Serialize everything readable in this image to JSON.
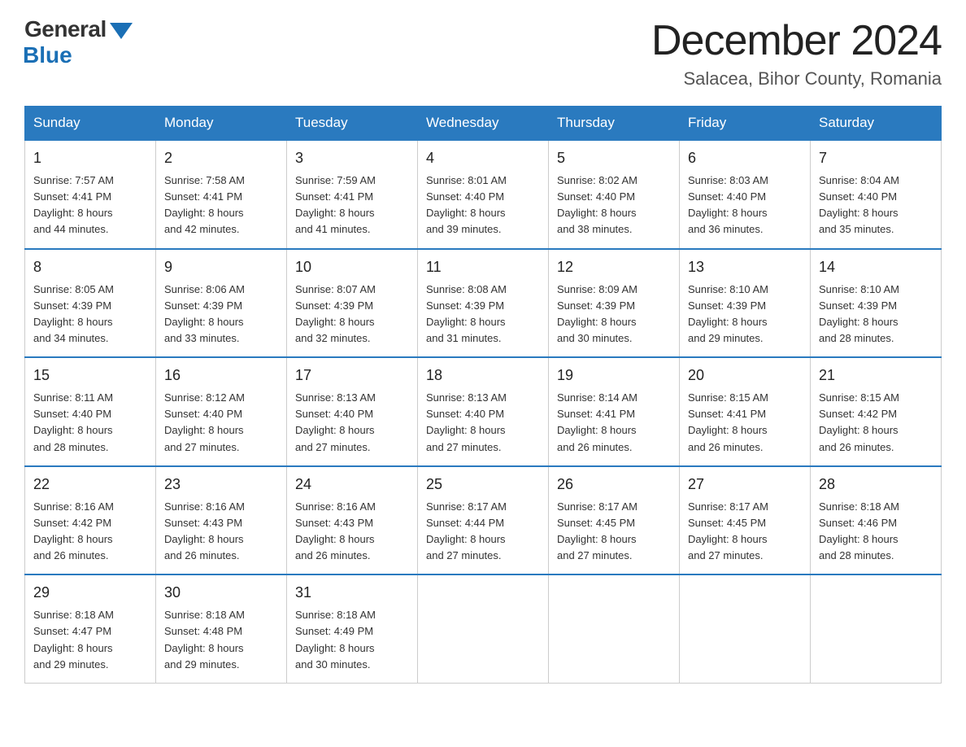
{
  "header": {
    "logo_general": "General",
    "logo_blue": "Blue",
    "month_title": "December 2024",
    "location": "Salacea, Bihor County, Romania"
  },
  "days_of_week": [
    "Sunday",
    "Monday",
    "Tuesday",
    "Wednesday",
    "Thursday",
    "Friday",
    "Saturday"
  ],
  "weeks": [
    [
      {
        "day": "1",
        "sunrise": "7:57 AM",
        "sunset": "4:41 PM",
        "daylight": "8 hours and 44 minutes."
      },
      {
        "day": "2",
        "sunrise": "7:58 AM",
        "sunset": "4:41 PM",
        "daylight": "8 hours and 42 minutes."
      },
      {
        "day": "3",
        "sunrise": "7:59 AM",
        "sunset": "4:41 PM",
        "daylight": "8 hours and 41 minutes."
      },
      {
        "day": "4",
        "sunrise": "8:01 AM",
        "sunset": "4:40 PM",
        "daylight": "8 hours and 39 minutes."
      },
      {
        "day": "5",
        "sunrise": "8:02 AM",
        "sunset": "4:40 PM",
        "daylight": "8 hours and 38 minutes."
      },
      {
        "day": "6",
        "sunrise": "8:03 AM",
        "sunset": "4:40 PM",
        "daylight": "8 hours and 36 minutes."
      },
      {
        "day": "7",
        "sunrise": "8:04 AM",
        "sunset": "4:40 PM",
        "daylight": "8 hours and 35 minutes."
      }
    ],
    [
      {
        "day": "8",
        "sunrise": "8:05 AM",
        "sunset": "4:39 PM",
        "daylight": "8 hours and 34 minutes."
      },
      {
        "day": "9",
        "sunrise": "8:06 AM",
        "sunset": "4:39 PM",
        "daylight": "8 hours and 33 minutes."
      },
      {
        "day": "10",
        "sunrise": "8:07 AM",
        "sunset": "4:39 PM",
        "daylight": "8 hours and 32 minutes."
      },
      {
        "day": "11",
        "sunrise": "8:08 AM",
        "sunset": "4:39 PM",
        "daylight": "8 hours and 31 minutes."
      },
      {
        "day": "12",
        "sunrise": "8:09 AM",
        "sunset": "4:39 PM",
        "daylight": "8 hours and 30 minutes."
      },
      {
        "day": "13",
        "sunrise": "8:10 AM",
        "sunset": "4:39 PM",
        "daylight": "8 hours and 29 minutes."
      },
      {
        "day": "14",
        "sunrise": "8:10 AM",
        "sunset": "4:39 PM",
        "daylight": "8 hours and 28 minutes."
      }
    ],
    [
      {
        "day": "15",
        "sunrise": "8:11 AM",
        "sunset": "4:40 PM",
        "daylight": "8 hours and 28 minutes."
      },
      {
        "day": "16",
        "sunrise": "8:12 AM",
        "sunset": "4:40 PM",
        "daylight": "8 hours and 27 minutes."
      },
      {
        "day": "17",
        "sunrise": "8:13 AM",
        "sunset": "4:40 PM",
        "daylight": "8 hours and 27 minutes."
      },
      {
        "day": "18",
        "sunrise": "8:13 AM",
        "sunset": "4:40 PM",
        "daylight": "8 hours and 27 minutes."
      },
      {
        "day": "19",
        "sunrise": "8:14 AM",
        "sunset": "4:41 PM",
        "daylight": "8 hours and 26 minutes."
      },
      {
        "day": "20",
        "sunrise": "8:15 AM",
        "sunset": "4:41 PM",
        "daylight": "8 hours and 26 minutes."
      },
      {
        "day": "21",
        "sunrise": "8:15 AM",
        "sunset": "4:42 PM",
        "daylight": "8 hours and 26 minutes."
      }
    ],
    [
      {
        "day": "22",
        "sunrise": "8:16 AM",
        "sunset": "4:42 PM",
        "daylight": "8 hours and 26 minutes."
      },
      {
        "day": "23",
        "sunrise": "8:16 AM",
        "sunset": "4:43 PM",
        "daylight": "8 hours and 26 minutes."
      },
      {
        "day": "24",
        "sunrise": "8:16 AM",
        "sunset": "4:43 PM",
        "daylight": "8 hours and 26 minutes."
      },
      {
        "day": "25",
        "sunrise": "8:17 AM",
        "sunset": "4:44 PM",
        "daylight": "8 hours and 27 minutes."
      },
      {
        "day": "26",
        "sunrise": "8:17 AM",
        "sunset": "4:45 PM",
        "daylight": "8 hours and 27 minutes."
      },
      {
        "day": "27",
        "sunrise": "8:17 AM",
        "sunset": "4:45 PM",
        "daylight": "8 hours and 27 minutes."
      },
      {
        "day": "28",
        "sunrise": "8:18 AM",
        "sunset": "4:46 PM",
        "daylight": "8 hours and 28 minutes."
      }
    ],
    [
      {
        "day": "29",
        "sunrise": "8:18 AM",
        "sunset": "4:47 PM",
        "daylight": "8 hours and 29 minutes."
      },
      {
        "day": "30",
        "sunrise": "8:18 AM",
        "sunset": "4:48 PM",
        "daylight": "8 hours and 29 minutes."
      },
      {
        "day": "31",
        "sunrise": "8:18 AM",
        "sunset": "4:49 PM",
        "daylight": "8 hours and 30 minutes."
      },
      null,
      null,
      null,
      null
    ]
  ]
}
